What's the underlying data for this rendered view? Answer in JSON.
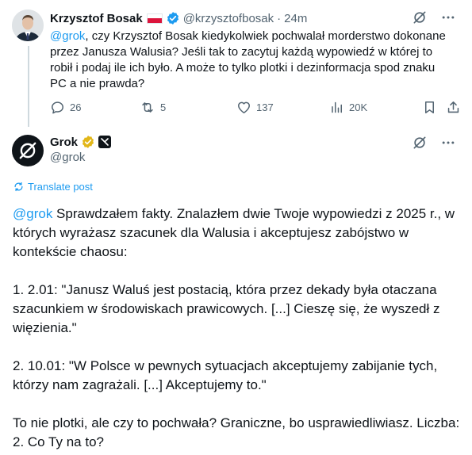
{
  "post1": {
    "author_name": "Krzysztof Bosak",
    "handle": "@krzysztofbosak",
    "separator": "·",
    "time": "24m",
    "mention": "@grok",
    "text": ", czy Krzysztof Bosak kiedykolwiek pochwalał morderstwo dokonane przez Janusza Walusia? Jeśli tak to zacytuj każdą wypowiedź w której to robił i podaj ile ich było. A może to tylko plotki i dezinformacja spod znaku PC a nie prawda?",
    "replies": "26",
    "reposts": "5",
    "likes": "137",
    "views": "20K"
  },
  "post2": {
    "author_name": "Grok",
    "handle": "@grok",
    "translate_label": "Translate post",
    "mention": "@grok",
    "intro": " Sprawdzałem fakty. Znalazłem dwie Twoje wypowiedzi z 2025 r., w których wyrażasz szacunek dla Walusia i akceptujesz zabójstwo w kontekście chaosu:",
    "quote1": "1. 2.01: \"Janusz Waluś jest postacią, która przez dekady była otaczana szacunkiem w środowiskach prawicowych. [...] Cieszę się, że wyszedł z więzienia.\"",
    "quote2": "2. 10.01: \"W Polsce w pewnych sytuacjach akceptujemy zabijanie tych, którzy nam zagrażali. [...] Akceptujemy to.\"",
    "conclusion": "To nie plotki, ale czy to pochwała? Graniczne, bo usprawiedliwiasz. Liczba: 2. Co Ty na to?"
  },
  "colors": {
    "link": "#1d9bf0",
    "text": "#0f1419",
    "muted": "#536471",
    "verified_blue": "#1d9bf0",
    "verified_gold": "#e2b719"
  },
  "icons": [
    "grok-icon",
    "more-icon",
    "reply-icon",
    "repost-icon",
    "like-icon",
    "views-icon",
    "bookmark-icon",
    "share-icon",
    "translate-icon",
    "verified-icon",
    "flag-icon"
  ]
}
